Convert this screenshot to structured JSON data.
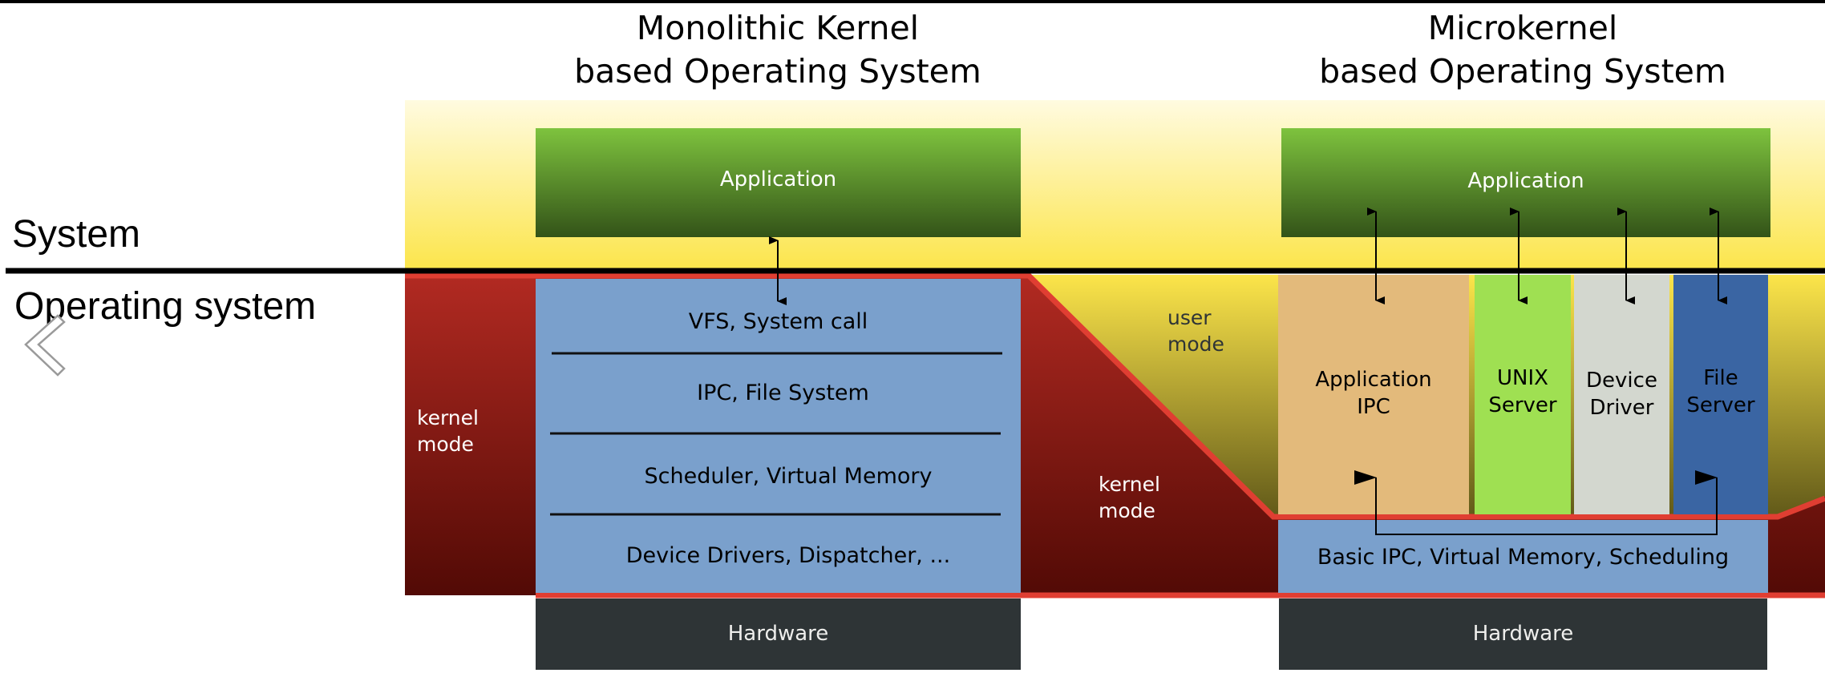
{
  "titles": {
    "monolithic": [
      "Monolithic Kernel",
      "based Operating System"
    ],
    "microkernel": [
      "Microkernel",
      "based Operating System"
    ]
  },
  "side_labels": {
    "system": "System",
    "operating_system": "Operating system"
  },
  "navigation": {
    "previous_icon": "chevron-left-icon"
  },
  "monolithic": {
    "application": "Application",
    "kernel_mode": [
      "kernel",
      "mode"
    ],
    "layers": [
      "VFS, System call",
      "IPC, File System",
      "Scheduler, Virtual Memory",
      "Device Drivers, Dispatcher, ..."
    ],
    "hardware": "Hardware"
  },
  "microkernel": {
    "application": "Application",
    "user_mode": [
      "user",
      "mode"
    ],
    "kernel_mode": [
      "kernel",
      "mode"
    ],
    "servers": [
      {
        "lines": [
          "Application",
          "IPC"
        ],
        "color": "#e3ba7b"
      },
      {
        "lines": [
          "UNIX",
          "Server"
        ],
        "color": "#9fe052"
      },
      {
        "lines": [
          "Device",
          "Driver"
        ],
        "color": "#d3d7cf"
      },
      {
        "lines": [
          "File",
          "Server"
        ],
        "color": "#3a65a3"
      }
    ],
    "kernel": "Basic IPC, Virtual Memory, Scheduling",
    "hardware": "Hardware"
  },
  "colors": {
    "user_space_top": "#fffbe0",
    "user_space_bottom": "#fce54a",
    "kernel_top": "#b22a22",
    "kernel_bottom": "#520a05",
    "boundary": "#e03e32",
    "kernel_block": "#7aa0cc",
    "hardware": "#2e3436",
    "app_top": "#7ec33e",
    "app_bottom": "#335318"
  }
}
